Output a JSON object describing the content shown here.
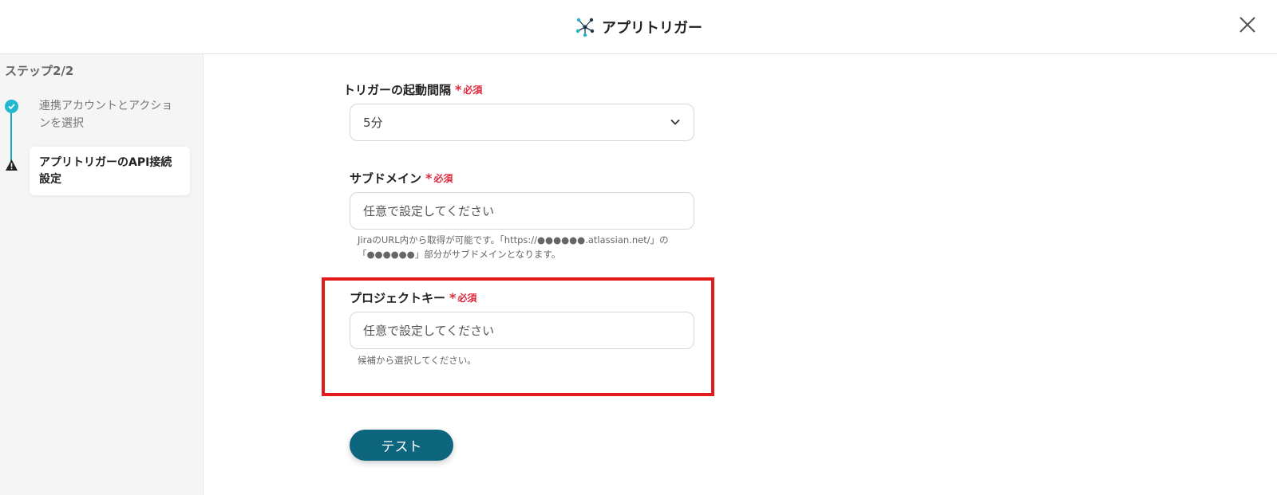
{
  "header": {
    "title": "アプリトリガー",
    "icon": "network-icon",
    "close_icon": "close-icon"
  },
  "sidebar": {
    "step_label": "ステップ2/2",
    "steps": [
      {
        "label": "連携アカウントとアクションを選択",
        "status": "done"
      },
      {
        "label": "アプリトリガーのAPI接続設定",
        "status": "warning"
      }
    ]
  },
  "form": {
    "interval": {
      "label": "トリガーの起動間隔",
      "required_mark": "*",
      "required_text": "必須",
      "value": "5分"
    },
    "subdomain": {
      "label": "サブドメイン",
      "required_mark": "*",
      "required_text": "必須",
      "placeholder": "任意で設定してください",
      "help_line1": "JiraのURL内から取得が可能です。「https://●●●●●●.atlassian.net/」の",
      "help_line2": "「●●●●●●」部分がサブドメインとなります。"
    },
    "project_key": {
      "label": "プロジェクトキー",
      "required_mark": "*",
      "required_text": "必須",
      "placeholder": "任意で設定してください",
      "help": "候補から選択してください。"
    },
    "test_button": "テスト"
  },
  "colors": {
    "accent": "#0e667e",
    "required": "#e0283c",
    "highlight": "#e21a1a",
    "step_done": "#22b8cf"
  }
}
